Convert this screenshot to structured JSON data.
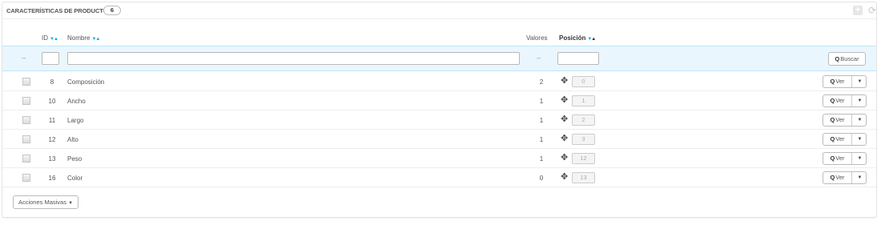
{
  "panel": {
    "title": "CARACTERÍSTICAS DE PRODUCTOS",
    "count": "6",
    "add_icon": "plus-icon",
    "refresh_icon": "refresh-icon"
  },
  "columns": {
    "id": "ID",
    "name": "Nombre",
    "values": "Valores",
    "position": "Posición"
  },
  "filter": {
    "dash": "--",
    "values_dash": "--",
    "id_value": "",
    "name_value": "",
    "position_value": "",
    "search_label": "Buscar"
  },
  "rows": [
    {
      "id": "8",
      "name": "Composición",
      "values": "2",
      "position": "0"
    },
    {
      "id": "10",
      "name": "Ancho",
      "values": "1",
      "position": "1"
    },
    {
      "id": "11",
      "name": "Largo",
      "values": "1",
      "position": "2"
    },
    {
      "id": "12",
      "name": "Alto",
      "values": "1",
      "position": "3"
    },
    {
      "id": "13",
      "name": "Peso",
      "values": "1",
      "position": "12"
    },
    {
      "id": "16",
      "name": "Color",
      "values": "0",
      "position": "13"
    }
  ],
  "row_action": {
    "view_label": "Ver"
  },
  "bulk": {
    "label": "Acciones Masivas"
  },
  "colors": {
    "accent": "#00aff0",
    "filter_bg": "#eaf6fd"
  }
}
